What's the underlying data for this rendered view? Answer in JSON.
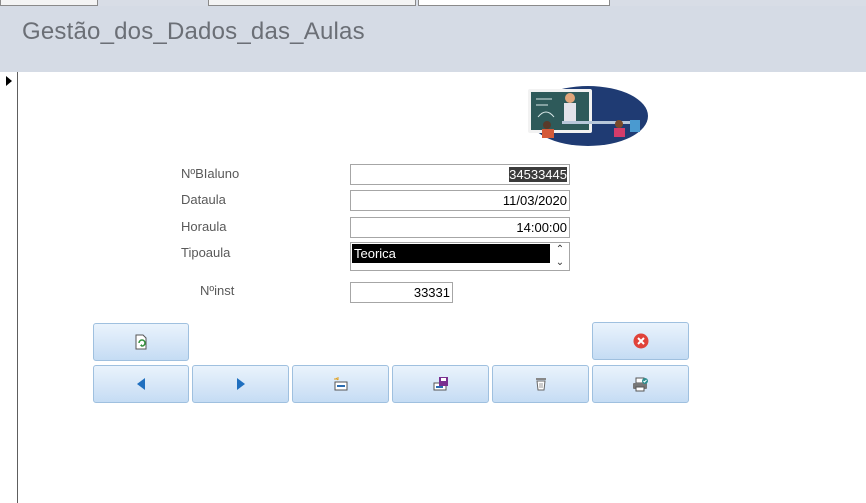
{
  "form": {
    "title": "Gestão_dos_Dados_das_Aulas"
  },
  "fields": {
    "nbialuno": {
      "label": "NºBIaluno",
      "value": "34533445"
    },
    "dataula": {
      "label": "Dataula",
      "value": "11/03/2020"
    },
    "horaula": {
      "label": "Horaula",
      "value": "14:00:00"
    },
    "tipoaula": {
      "label": "Tipoaula",
      "value": "Teorica"
    },
    "ninst": {
      "label": "Nºinst",
      "value": "33331"
    }
  },
  "icons": {
    "refresh": "refresh-icon",
    "close": "close-circle-icon",
    "previous": "previous-record-icon",
    "next": "next-record-icon",
    "new": "new-record-icon",
    "save": "save-icon",
    "delete": "delete-icon",
    "print": "print-icon"
  },
  "colors": {
    "header_bg": "#d5dbe5",
    "button_top": "#eaf3fc",
    "button_bottom": "#c5dcf4",
    "close_red": "#e0433a",
    "arrow_blue": "#1f6fbf"
  }
}
